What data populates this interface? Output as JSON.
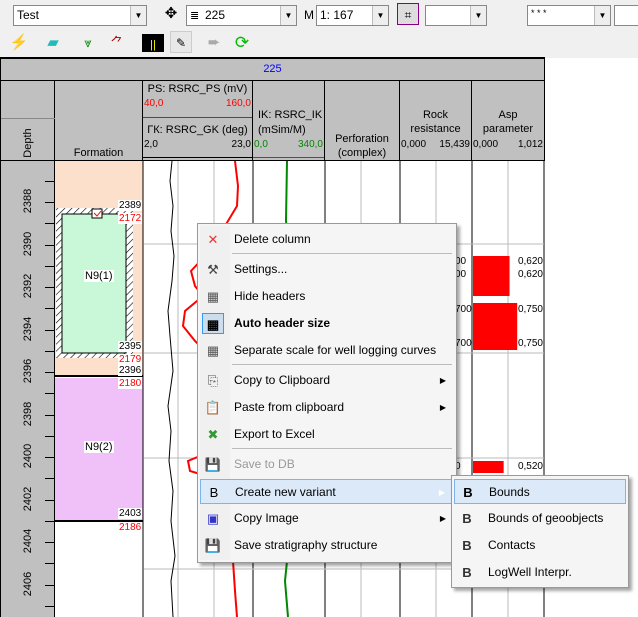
{
  "toolbar": {
    "well_combo": "Test",
    "trace_combo": "225",
    "scale_prefix": "M",
    "scale_combo": "1: 167",
    "search_combo": "",
    "line_style_combo": "* * *",
    "icons": [
      "lightning-icon",
      "eraser-icon",
      "filter-curve-icon",
      "curve-marker-icon",
      "track-columns-icon",
      "pencil-icon",
      "arrow-icon",
      "refresh-icon"
    ]
  },
  "track": {
    "title": "225",
    "columns": {
      "depth": "Depth",
      "formation": "Formation",
      "ps": {
        "name": "PS: RSRC_PS (mV)",
        "min": "40,0",
        "max": "160,0",
        "color": "#ff0000"
      },
      "gk": {
        "name": "ГК: RSRC_GK (deg)",
        "min": "2,0",
        "max": "23,0",
        "color": "#000000"
      },
      "ik": {
        "name1": "IK: RSRC_IK",
        "name2": "(mSim/M)",
        "min": "0,0",
        "max": "340,0",
        "color": "#008000"
      },
      "perforation": {
        "line1": "Perforation",
        "line2": "(complex)"
      },
      "rock": {
        "line1": "Rock",
        "line2": "resistance",
        "min": "0,000",
        "max": "15,439"
      },
      "asp": {
        "line1": "Asp",
        "line2": "parameter",
        "min": "0,000",
        "max": "1,012"
      }
    },
    "depth_labels": [
      "2388",
      "2390",
      "2392",
      "2394",
      "2396",
      "2398",
      "2400",
      "2402",
      "2404",
      "2406"
    ],
    "formations": [
      {
        "name": "N9(1)",
        "top_md": "2389",
        "top_tvd": "2172",
        "bot_md": "2395",
        "bot_tvd": "2179",
        "color": "#c8f8d8"
      },
      {
        "name": "N9(2)",
        "top_md": "2396",
        "top_tvd": "2180",
        "bot_md": "2403",
        "bot_tvd": "2186",
        "color": "#f0c0f8"
      }
    ],
    "rock_values": [
      "00",
      "00",
      "700",
      "700",
      "0"
    ],
    "asp_values": [
      "0,620",
      "0,620",
      "0,750",
      "0,750",
      "0,520"
    ],
    "asp_bars": [
      0.62,
      0.75,
      0.52
    ]
  },
  "context_menu": {
    "items": [
      {
        "label": "Delete column",
        "icon": "delete-x-icon"
      },
      {
        "label": "Settings...",
        "icon": "settings-tools-icon"
      },
      {
        "label": "Hide headers",
        "icon": "hide-headers-icon"
      },
      {
        "label": "Auto header size",
        "icon": "auto-header-icon"
      },
      {
        "label": "Separate scale for well logging curves",
        "icon": "separate-scale-icon"
      },
      {
        "label": "Copy to Clipboard",
        "icon": "copy-icon"
      },
      {
        "label": "Paste from clipboard",
        "icon": "paste-icon"
      },
      {
        "label": "Export to Excel",
        "icon": "excel-icon"
      },
      {
        "label": "Save to DB",
        "icon": "save-db-icon"
      },
      {
        "label": "Create new variant",
        "icon": "new-variant-icon"
      },
      {
        "label": "Copy Image",
        "icon": "bmp-icon"
      },
      {
        "label": "Save stratigraphy structure",
        "icon": "floppy-icon"
      }
    ]
  },
  "submenu": {
    "items": [
      {
        "label": "Bounds",
        "icon": "bounds-icon"
      },
      {
        "label": "Bounds of geoobjects",
        "icon": "geoobject-bounds-icon"
      },
      {
        "label": "Contacts",
        "icon": "contacts-icon"
      },
      {
        "label": "LogWell Interpr.",
        "icon": "logwell-icon"
      }
    ]
  }
}
